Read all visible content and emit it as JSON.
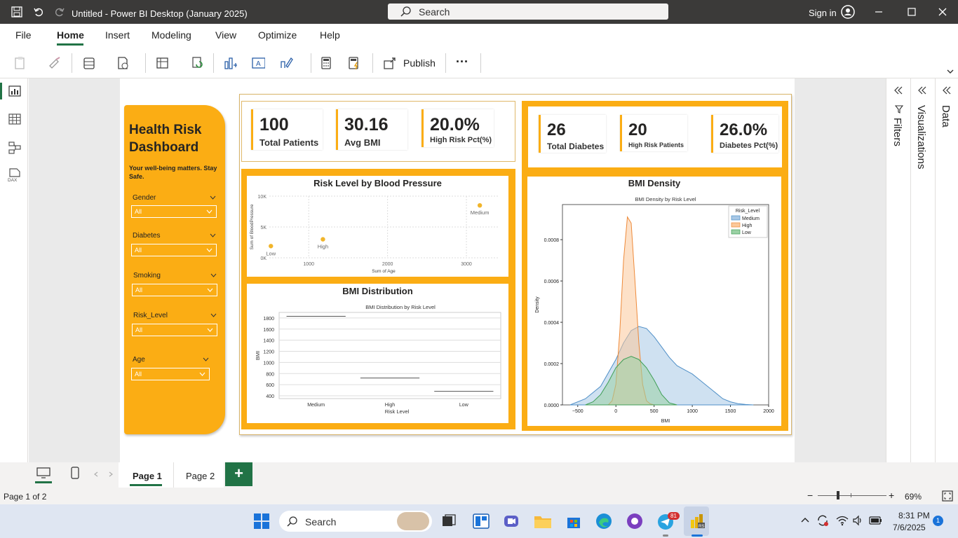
{
  "window": {
    "title": "Untitled - Power BI Desktop (January 2025)",
    "search_placeholder": "Search",
    "sign_in": "Sign in"
  },
  "menu": [
    "File",
    "Home",
    "Insert",
    "Modeling",
    "View",
    "Optimize",
    "Help"
  ],
  "ribbon": {
    "publish": "Publish",
    "more": "···"
  },
  "panes": {
    "filters": "Filters",
    "visualizations": "Visualizations",
    "data": "Data"
  },
  "pages": {
    "page1": "Page 1",
    "page2": "Page 2",
    "add": "+"
  },
  "status": {
    "page_info": "Page 1 of 2",
    "zoom": "69%"
  },
  "taskbar": {
    "search": "Search",
    "time": "8:31 PM",
    "date": "7/6/2025",
    "notif": "1",
    "badge": "81"
  },
  "dashboard": {
    "title_line1": "Health Risk",
    "title_line2": "Dashboard",
    "tagline": "Your well-being matters. Stay Safe.",
    "slicers": [
      {
        "label": "Gender",
        "value": "All"
      },
      {
        "label": "Diabetes",
        "value": "All"
      },
      {
        "label": "Smoking",
        "value": "All"
      },
      {
        "label": "Risk_Level",
        "value": "All"
      },
      {
        "label": "Age",
        "value": "All"
      }
    ],
    "cards_left": [
      {
        "value": "100",
        "label": "Total Patients"
      },
      {
        "value": "30.16",
        "label": "Avg BMI"
      },
      {
        "value": "20.0%",
        "label": "High Risk Pct(%)"
      }
    ],
    "cards_right": [
      {
        "value": "26",
        "label": "Total Diabetes"
      },
      {
        "value": "20",
        "label": "High Risk Patients"
      },
      {
        "value": "26.0%",
        "label": "Diabetes Pct(%)"
      }
    ],
    "visual_titles": {
      "scatter": "Risk Level by Blood Pressure",
      "box": "BMI Distribution",
      "density": "BMI Density"
    }
  },
  "chart_data": [
    {
      "type": "scatter",
      "title": "Risk Level by Blood Pressure",
      "xlabel": "Sum of Age",
      "ylabel": "Sum of BloodPressure",
      "xticks": [
        "1000",
        "2000",
        "3000"
      ],
      "yticks": [
        "0K",
        "5K",
        "10K"
      ],
      "xlim": [
        500,
        3400
      ],
      "ylim": [
        0,
        10000
      ],
      "points": [
        {
          "label": "Low",
          "x": 520,
          "y": 1900
        },
        {
          "label": "High",
          "x": 1180,
          "y": 3000
        },
        {
          "label": "Medium",
          "x": 3170,
          "y": 8500
        }
      ]
    },
    {
      "type": "bar",
      "title": "BMI Distribution by Risk Level",
      "xlabel": "Risk Level",
      "ylabel": "BMI",
      "categories": [
        "Medium",
        "High",
        "Low"
      ],
      "values": [
        1830,
        720,
        480
      ],
      "yticks": [
        "400",
        "600",
        "800",
        "1000",
        "1200",
        "1400",
        "1600",
        "1800"
      ],
      "ylim": [
        350,
        1900
      ]
    },
    {
      "type": "area",
      "title": "BMI Density by Risk Level",
      "xlabel": "BMI",
      "ylabel": "Density",
      "legend_title": "Risk_Level",
      "legend_placement": "top-right",
      "xticks": [
        "−500",
        "0",
        "500",
        "1000",
        "1500",
        "2000"
      ],
      "yticks": [
        "0.0000",
        "0.0002",
        "0.0004",
        "0.0006",
        "0.0008"
      ],
      "xlim": [
        -700,
        2000
      ],
      "ylim": [
        0,
        0.00097
      ],
      "series": [
        {
          "name": "Medium",
          "color": "#a8c8e6",
          "stroke": "#4f8fc7",
          "x": [
            -600,
            -400,
            -200,
            0,
            100,
            200,
            300,
            400,
            500,
            600,
            700,
            800,
            900,
            1000,
            1100,
            1200,
            1300,
            1400,
            1500,
            1600,
            1700,
            1800
          ],
          "y": [
            0.0,
            3e-05,
            9e-05,
            0.00022,
            0.0003,
            0.00036,
            0.00038,
            0.00037,
            0.00033,
            0.00028,
            0.00023,
            0.00019,
            0.00017,
            0.00015,
            0.00012,
            9e-05,
            6e-05,
            3e-05,
            1.5e-05,
            6e-06,
            2e-06,
            0.0
          ]
        },
        {
          "name": "High",
          "color": "#fbc89a",
          "stroke": "#ee8a3a",
          "x": [
            -100,
            -50,
            0,
            50,
            100,
            150,
            200,
            250,
            300,
            350,
            400,
            450,
            500
          ],
          "y": [
            0.0,
            2e-05,
            0.0001,
            0.00035,
            0.0007,
            0.00091,
            0.00088,
            0.0006,
            0.0003,
            0.0001,
            2e-05,
            5e-06,
            0.0
          ]
        },
        {
          "name": "Low",
          "color": "#9ad1a4",
          "stroke": "#3f9e56",
          "x": [
            -400,
            -300,
            -200,
            -100,
            0,
            100,
            200,
            300,
            400,
            500,
            600,
            700,
            800
          ],
          "y": [
            0.0,
            1.5e-05,
            5e-05,
            0.00011,
            0.00018,
            0.00022,
            0.000235,
            0.00022,
            0.00018,
            0.00012,
            5e-05,
            1e-05,
            0.0
          ]
        }
      ]
    }
  ],
  "colors": {
    "accent": "#fbad14",
    "titlebar": "#3b3a39",
    "tab_active": "#217346"
  }
}
